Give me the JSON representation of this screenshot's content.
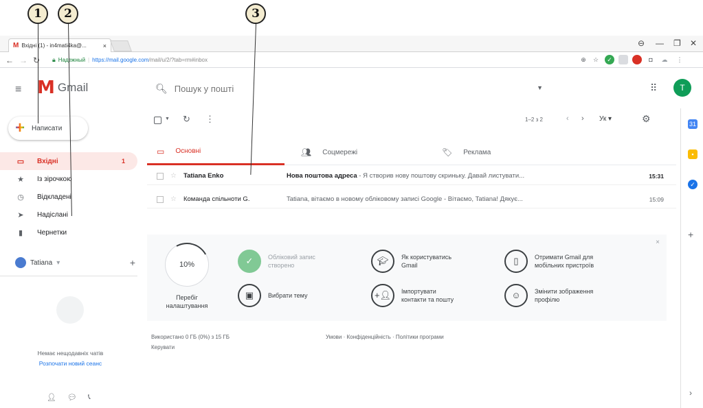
{
  "callouts": [
    "1",
    "2",
    "3"
  ],
  "browser": {
    "tab_title": "Вхідні (1) - in4mati4ka@...",
    "tab_close": "×",
    "window_controls": [
      "⊖",
      "—",
      "❐",
      "✕"
    ],
    "secure_label": "Надежный",
    "url_host": "https://mail.google.com",
    "url_path": "/mail/u/2/?tab=rm#inbox"
  },
  "gmail": {
    "brand": "Gmail",
    "search_placeholder": "Пошук у пошті",
    "avatar_letter": "T",
    "compose_label": "Написати"
  },
  "sidebar": {
    "items": [
      {
        "label": "Вхідні",
        "count": "1",
        "icon": "inbox-icon"
      },
      {
        "label": "Із зірочкою",
        "count": "",
        "icon": "star-icon"
      },
      {
        "label": "Відкладені",
        "count": "",
        "icon": "clock-icon"
      },
      {
        "label": "Надіслані",
        "count": "",
        "icon": "send-icon"
      },
      {
        "label": "Чернетки",
        "count": "",
        "icon": "draft-icon"
      }
    ],
    "user_name": "Tatiana",
    "no_chats": "Немає нещодавніх чатів",
    "start_session": "Розпочати новий сеанс"
  },
  "toolbar": {
    "pager": "1–2 з 2",
    "lang": "Ук"
  },
  "tabs": [
    {
      "label": "Основні",
      "active": true
    },
    {
      "label": "Соцмережі",
      "active": false
    },
    {
      "label": "Реклама",
      "active": false
    }
  ],
  "emails": [
    {
      "sender": "Tatiana Enko",
      "subject": "Нова поштова адреса",
      "snippet": " - Я створив нову поштову скриньку. Давай листувати...",
      "time": "15:31",
      "unread": true
    },
    {
      "sender": "Команда спільноти G.",
      "subject": "",
      "snippet": "Tatiana, вітаємо в новому обліковому записі Google - Вітаємо, Tatiana! Дякує...",
      "time": "15:09",
      "unread": false
    }
  ],
  "setup": {
    "progress_percent": 10,
    "progress_label": "10%",
    "caption_line1": "Перебіг",
    "caption_line2": "налаштування",
    "items": [
      {
        "label_line1": "Обліковий запис",
        "label_line2": "створено",
        "icon": "check-icon",
        "done": true
      },
      {
        "label_line1": "Як користуватись",
        "label_line2": "Gmail",
        "icon": "graduation-cap-icon",
        "done": false
      },
      {
        "label_line1": "Отримати Gmail для",
        "label_line2": "мобільних пристроїв",
        "icon": "phone-icon",
        "done": false
      },
      {
        "label_line1": "Вибрати тему",
        "label_line2": "",
        "icon": "image-icon",
        "done": false
      },
      {
        "label_line1": "Імпортувати",
        "label_line2": "контакти та пошту",
        "icon": "person-add-icon",
        "done": false
      },
      {
        "label_line1": "Змінити зображення",
        "label_line2": "профілю",
        "icon": "account-circle-icon",
        "done": false
      }
    ]
  },
  "footer": {
    "storage": "Використано 0 ГБ (0%) з 15 ГБ",
    "manage": "Керувати",
    "links": "Умови · Конфіденційність · Політики програми"
  },
  "colors": {
    "accent": "#d93025",
    "link": "#1a73e8",
    "secure": "#188038"
  }
}
